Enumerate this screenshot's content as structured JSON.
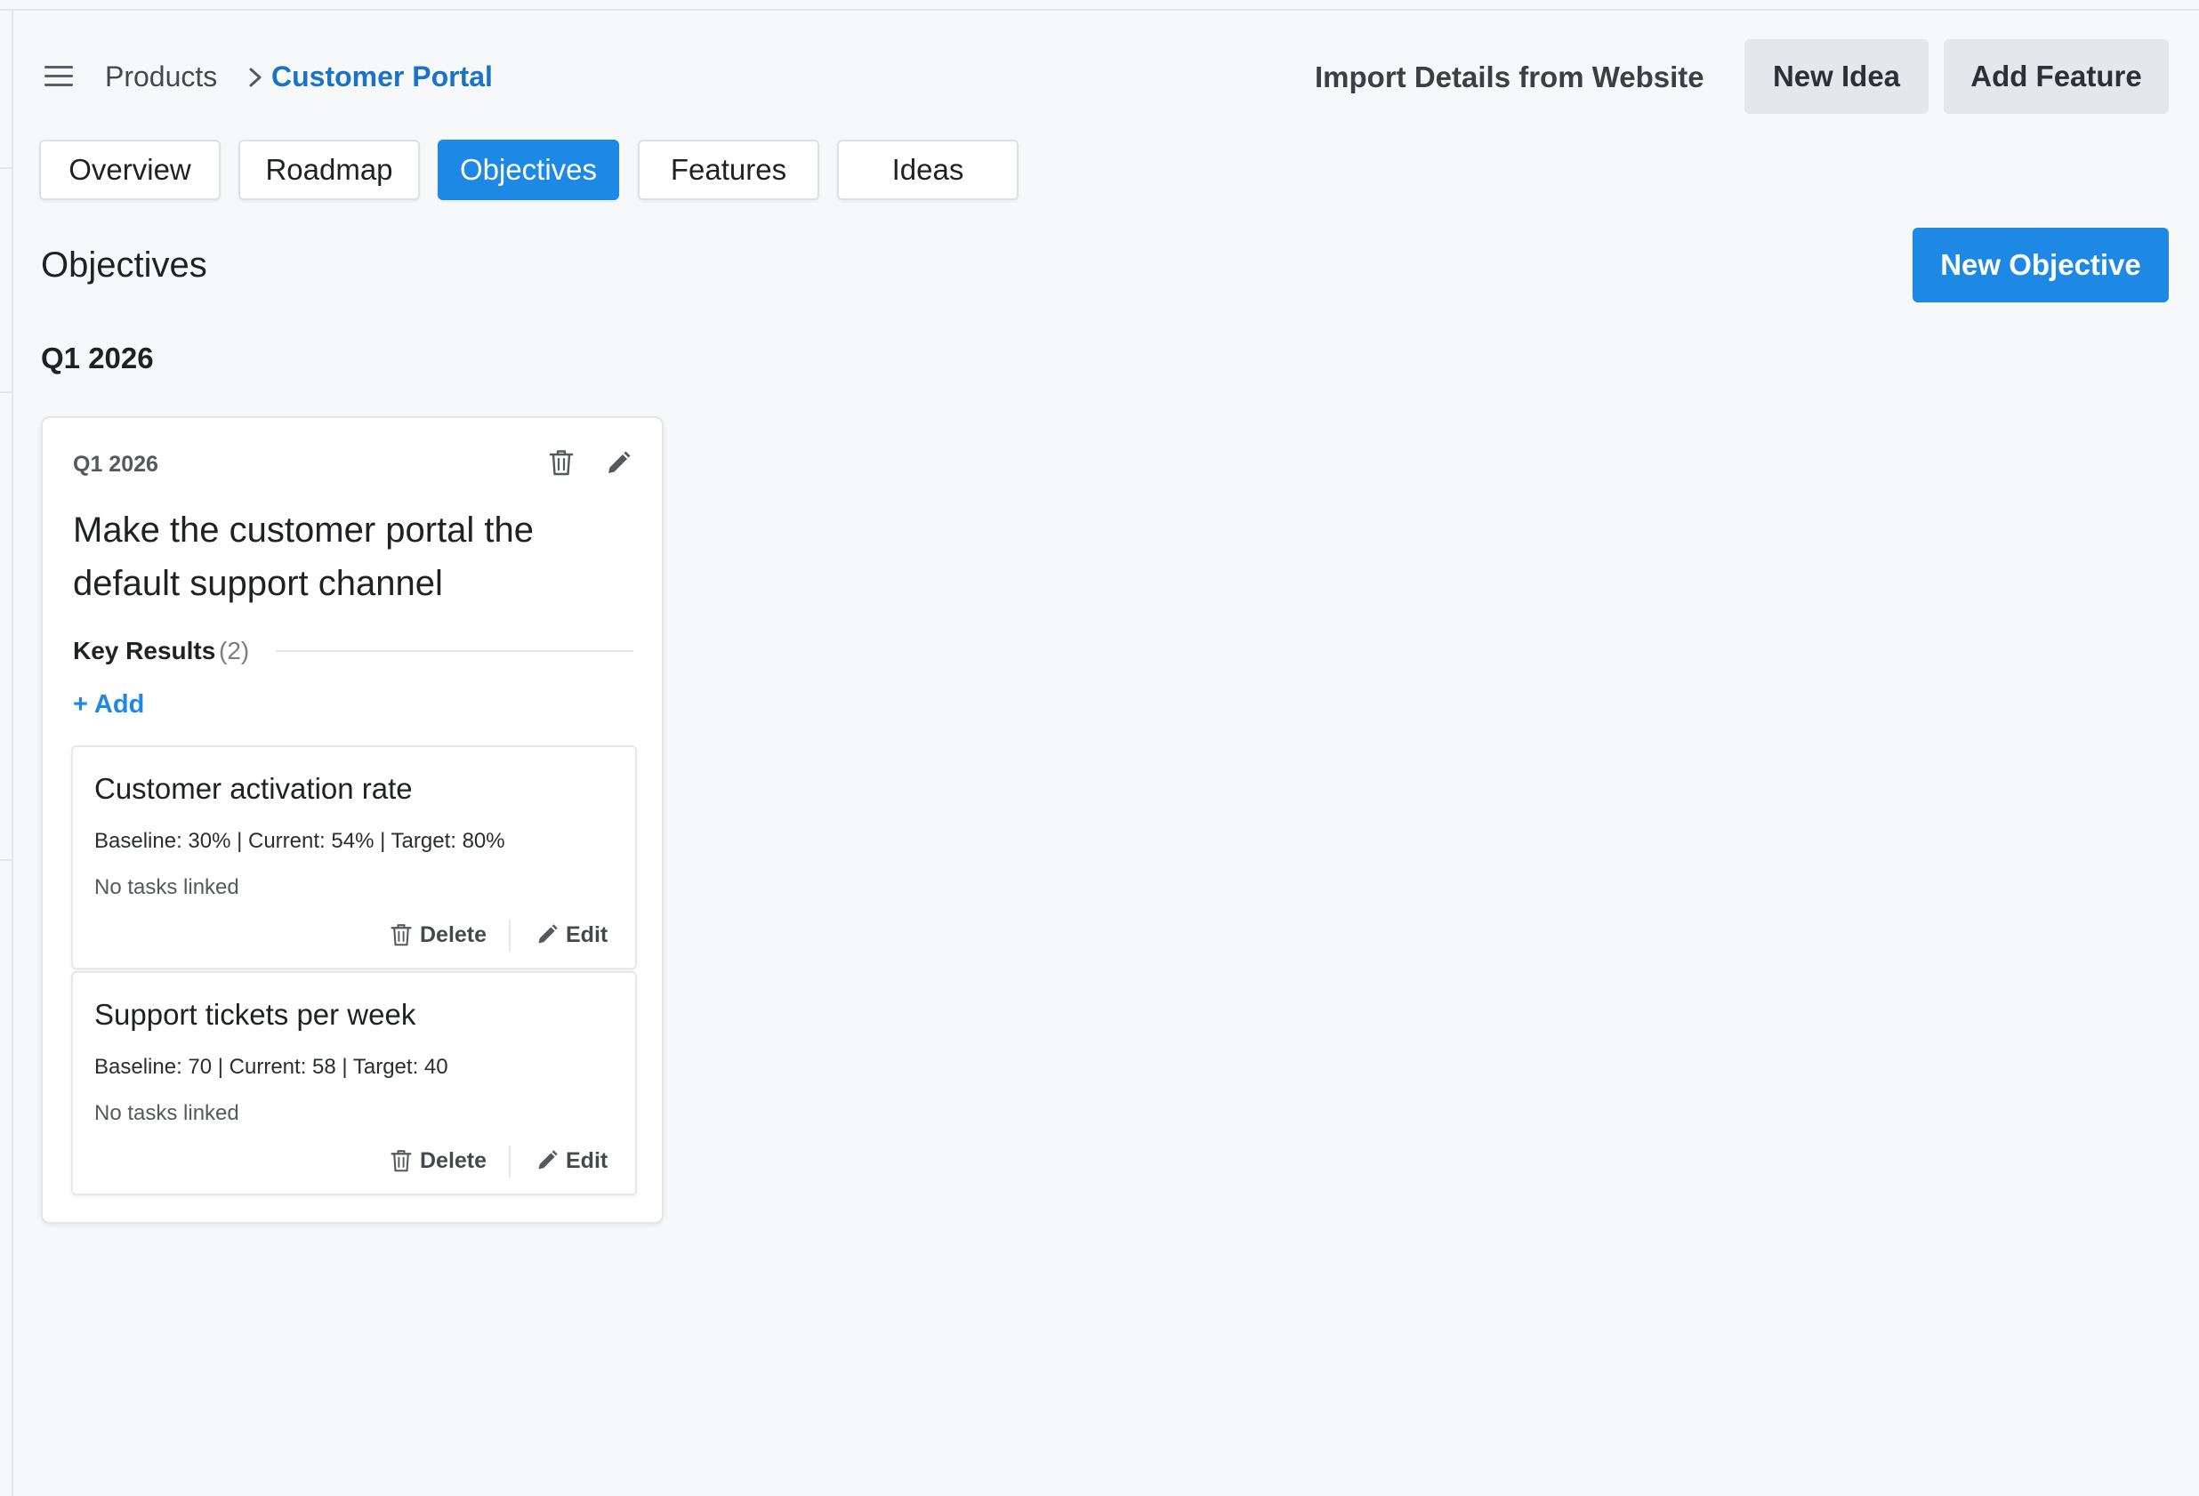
{
  "breadcrumb": {
    "root": "Products",
    "current": "Customer Portal"
  },
  "header": {
    "import_label": "Import Details from Website",
    "new_idea_label": "New Idea",
    "add_feature_label": "Add Feature"
  },
  "tabs": [
    {
      "label": "Overview",
      "active": false
    },
    {
      "label": "Roadmap",
      "active": false
    },
    {
      "label": "Objectives",
      "active": true
    },
    {
      "label": "Features",
      "active": false
    },
    {
      "label": "Ideas",
      "active": false
    }
  ],
  "section": {
    "title": "Objectives",
    "new_objective_label": "New Objective",
    "quarter_heading": "Q1 2026"
  },
  "objective": {
    "quarter": "Q1 2026",
    "title": "Make the customer portal the default support channel",
    "key_results_label": "Key Results",
    "key_results_count": "(2)",
    "add_label": "+ Add",
    "key_results": [
      {
        "title": "Customer activation rate",
        "metrics": "Baseline: 30% | Current: 54% | Target: 80%",
        "tasks": "No tasks linked",
        "delete_label": "Delete",
        "edit_label": "Edit"
      },
      {
        "title": "Support tickets per week",
        "metrics": "Baseline: 70 | Current: 58 | Target: 40",
        "tasks": "No tasks linked",
        "delete_label": "Delete",
        "edit_label": "Edit"
      }
    ]
  },
  "colors": {
    "accent": "#1e88e5",
    "link": "#1a73c7",
    "background": "#f7f8fa",
    "secondary_button": "#e6e7ea"
  },
  "icons": {
    "menu": "hamburger-menu-icon",
    "breadcrumb_separator": "chevron-right-icon",
    "delete": "trash-icon",
    "edit": "pencil-icon"
  }
}
